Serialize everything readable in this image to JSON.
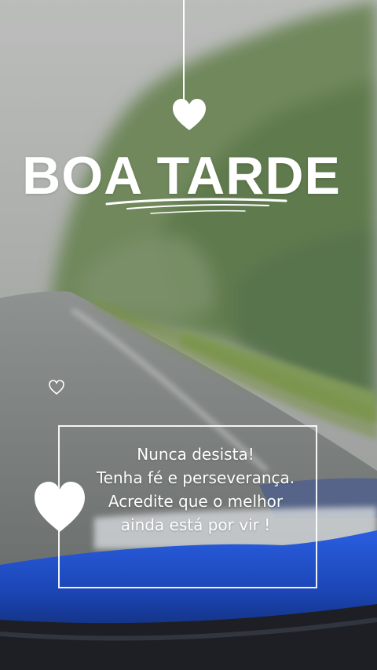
{
  "title": "BOA TARDE",
  "message": {
    "line1": "Nunca desista!",
    "line2": "Tenha fé e perseverança.",
    "line3": "Acredite que o melhor",
    "line4": "ainda está por vir !"
  },
  "icons": {
    "top": "heart-icon",
    "small": "heart-outline-icon",
    "large": "heart-icon"
  },
  "colors": {
    "text": "#ffffff",
    "foliage": "#4d6b34",
    "road": "#6f7370",
    "dashboard": "#1f4fc9"
  }
}
